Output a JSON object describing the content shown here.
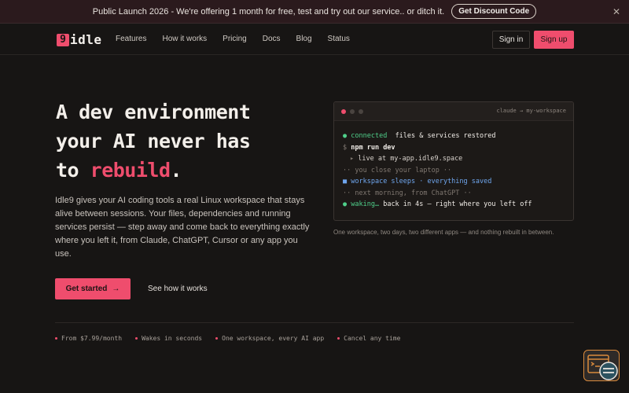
{
  "announcement": {
    "text": "Public Launch 2026 - We're offering 1 month for free, test and try out our service.. or ditch it.",
    "button": "Get Discount Code",
    "close": "✕"
  },
  "nav": {
    "logo_mark": "9",
    "logo_word": "idle",
    "links": [
      "Features",
      "How it works",
      "Pricing",
      "Docs",
      "Blog",
      "Status"
    ],
    "signin": "Sign in",
    "signup": "Sign up"
  },
  "hero": {
    "title_line1": "A dev environment",
    "title_line2": "your AI never has",
    "title_line3_prefix": "to ",
    "title_line3_accent": "rebuild",
    "title_line3_suffix": ".",
    "description": "Idle9 gives your AI coding tools a real Linux workspace that stays alive between sessions. Your files, dependencies and running services persist — step away and come back to everything exactly where you left it, from Claude, ChatGPT, Cursor or any app you use.",
    "cta_primary": "Get started",
    "cta_arrow": "→",
    "cta_secondary": "See how it works"
  },
  "terminal": {
    "title": "claude → my-workspace",
    "lines": {
      "l1_bullet": "●",
      "l1_status": "connected",
      "l1_text": "files & services restored",
      "l2_prompt": "$",
      "l2_cmd": "npm run dev",
      "l3_arrow": "▸",
      "l3_text": "live at my-app.idle9.space",
      "l4_text": "·· you close your laptop ··",
      "l5_bullet": "■",
      "l5_text": "workspace sleeps · everything saved",
      "l6_text": "·· next morning, from ChatGPT ··",
      "l7_bullet": "●",
      "l7_status": "waking…",
      "l7_text": "back in 4s — right where you left off"
    },
    "caption": "One workspace, two days, two different apps — and nothing rebuilt in between."
  },
  "features": [
    "From $7.99/month",
    "Wakes in seconds",
    "One workspace, every AI app",
    "Cancel any time"
  ],
  "colors": {
    "accent": "#ef4d6d",
    "background": "#171514",
    "terminal_green": "#4fcf8a",
    "terminal_blue": "#6fa6ee",
    "widget_orange": "#d98a3c"
  },
  "icons": {
    "close": "close-icon",
    "arrow": "arrow-right-icon",
    "chat": "chat-widget-icon"
  }
}
